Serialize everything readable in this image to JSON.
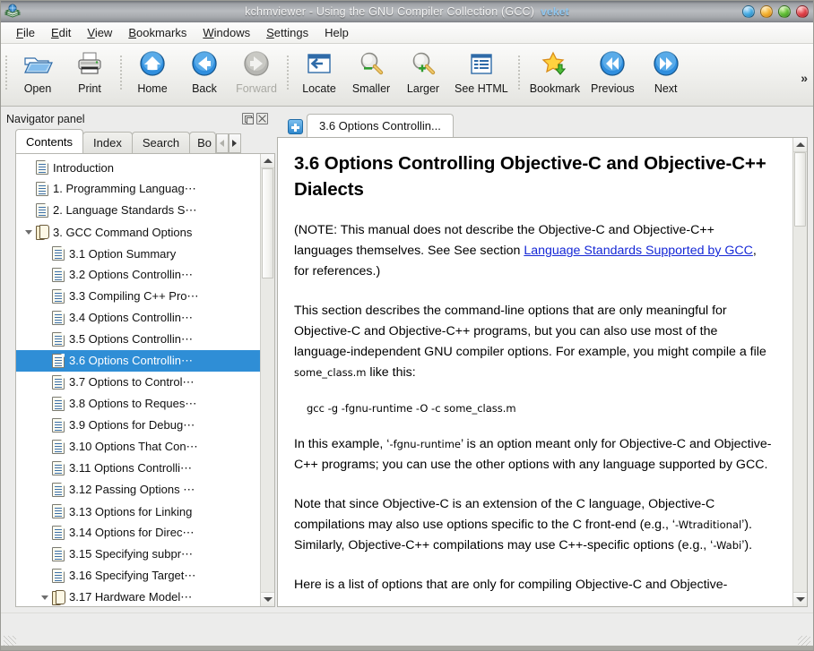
{
  "window": {
    "app_icon": "book-globe-icon",
    "title": "kchmviewer  -  Using  the  GNU  Compiler  Collection  (GCC)",
    "title_suffix": "veket",
    "buttons": [
      {
        "name": "shade-button",
        "color": "#49aee4"
      },
      {
        "name": "minimize-button",
        "color": "#f5b536"
      },
      {
        "name": "maximize-button",
        "color": "#66c23a"
      },
      {
        "name": "close-button",
        "color": "#e3484f"
      }
    ]
  },
  "menubar": {
    "items": [
      {
        "label": "File",
        "accel": "F"
      },
      {
        "label": "Edit",
        "accel": "E"
      },
      {
        "label": "View",
        "accel": "V"
      },
      {
        "label": "Bookmarks",
        "accel": "B"
      },
      {
        "label": "Windows",
        "accel": "W"
      },
      {
        "label": "Settings",
        "accel": "S"
      },
      {
        "label": "Help",
        "accel": "H"
      }
    ]
  },
  "toolbar": {
    "overflow_label": "»",
    "buttons": [
      {
        "label": "Open",
        "icon": "open-folder-icon",
        "disabled": false
      },
      {
        "label": "Print",
        "icon": "printer-icon",
        "disabled": false
      },
      {
        "label": "Home",
        "icon": "home-icon",
        "disabled": false
      },
      {
        "label": "Back",
        "icon": "back-arrow-icon",
        "disabled": false
      },
      {
        "label": "Forward",
        "icon": "forward-arrow-icon",
        "disabled": true
      },
      {
        "label": "Locate",
        "icon": "locate-icon",
        "disabled": false
      },
      {
        "label": "Smaller",
        "icon": "zoom-out-icon",
        "disabled": false
      },
      {
        "label": "Larger",
        "icon": "zoom-in-icon",
        "disabled": false
      },
      {
        "label": "See HTML",
        "icon": "see-html-icon",
        "disabled": false
      },
      {
        "label": "Bookmark",
        "icon": "bookmark-star-icon",
        "disabled": false
      },
      {
        "label": "Previous",
        "icon": "previous-icon",
        "disabled": false
      },
      {
        "label": "Next",
        "icon": "next-icon",
        "disabled": false
      }
    ]
  },
  "navigator": {
    "title": "Navigator panel",
    "float_icon": "float-panel-icon",
    "close_icon": "close-panel-icon",
    "tabs": [
      {
        "label": "Contents",
        "active": true
      },
      {
        "label": "Index",
        "active": false
      },
      {
        "label": "Search",
        "active": false
      },
      {
        "label": "Bo",
        "active": false,
        "clipped": true
      }
    ],
    "tab_scroll_left": "chevron-left-icon",
    "tab_scroll_right": "chevron-right-icon",
    "tree": [
      {
        "label": "Introduction",
        "indent": 1,
        "icon": "page-icon",
        "twisty": false,
        "selected": false
      },
      {
        "label": "1. Programming Languag⋯",
        "indent": 1,
        "icon": "page-icon",
        "twisty": false,
        "selected": false
      },
      {
        "label": "2. Language Standards S⋯",
        "indent": 1,
        "icon": "page-icon",
        "twisty": false,
        "selected": false
      },
      {
        "label": "3. GCC Command Options",
        "indent": 1,
        "icon": "book-icon",
        "twisty": true,
        "selected": false
      },
      {
        "label": "3.1 Option Summary",
        "indent": 2,
        "icon": "page-icon",
        "twisty": false,
        "selected": false
      },
      {
        "label": "3.2 Options Controllin⋯",
        "indent": 2,
        "icon": "page-icon",
        "twisty": false,
        "selected": false
      },
      {
        "label": "3.3 Compiling C++ Pro⋯",
        "indent": 2,
        "icon": "page-icon",
        "twisty": false,
        "selected": false
      },
      {
        "label": "3.4 Options Controllin⋯",
        "indent": 2,
        "icon": "page-icon",
        "twisty": false,
        "selected": false
      },
      {
        "label": "3.5 Options Controllin⋯",
        "indent": 2,
        "icon": "page-icon",
        "twisty": false,
        "selected": false
      },
      {
        "label": "3.6 Options Controllin⋯",
        "indent": 2,
        "icon": "page-icon",
        "twisty": false,
        "selected": true
      },
      {
        "label": "3.7 Options to Control⋯",
        "indent": 2,
        "icon": "page-icon",
        "twisty": false,
        "selected": false
      },
      {
        "label": "3.8 Options to Reques⋯",
        "indent": 2,
        "icon": "page-icon",
        "twisty": false,
        "selected": false
      },
      {
        "label": "3.9 Options for Debug⋯",
        "indent": 2,
        "icon": "page-icon",
        "twisty": false,
        "selected": false
      },
      {
        "label": "3.10 Options That Con⋯",
        "indent": 2,
        "icon": "page-icon",
        "twisty": false,
        "selected": false
      },
      {
        "label": "3.11 Options Controlli⋯",
        "indent": 2,
        "icon": "page-icon",
        "twisty": false,
        "selected": false
      },
      {
        "label": "3.12 Passing Options ⋯",
        "indent": 2,
        "icon": "page-icon",
        "twisty": false,
        "selected": false
      },
      {
        "label": "3.13 Options for Linking",
        "indent": 2,
        "icon": "page-icon",
        "twisty": false,
        "selected": false
      },
      {
        "label": "3.14 Options for Direc⋯",
        "indent": 2,
        "icon": "page-icon",
        "twisty": false,
        "selected": false
      },
      {
        "label": "3.15 Specifying subpr⋯",
        "indent": 2,
        "icon": "page-icon",
        "twisty": false,
        "selected": false
      },
      {
        "label": "3.16 Specifying Target⋯",
        "indent": 2,
        "icon": "page-icon",
        "twisty": false,
        "selected": false
      },
      {
        "label": "3.17 Hardware Model⋯",
        "indent": 2,
        "icon": "book-icon",
        "twisty": true,
        "selected": false
      }
    ],
    "scrollbar": {
      "up_icon": "scroll-up-icon",
      "down_icon": "scroll-down-icon",
      "thumb_top_pct": 0,
      "thumb_height_pct": 26
    }
  },
  "content": {
    "add_tab_icon": "add-tab-icon",
    "tabs": [
      {
        "label": "3.6 Options Controllin...",
        "active": true
      }
    ],
    "document": {
      "heading": "3.6 Options Controlling Objective-C and Objective-C++ Dialects",
      "para1_before_link": "(NOTE: This manual does not describe the Objective-C and Objective-C++ languages themselves. See See section ",
      "para1_link": "Language Standards Supported by GCC",
      "para1_after_link": ", for references.)",
      "para2_a": "This section describes the command-line options that are only meaningful for Objective-C and Objective-C++ programs, but you can also use most of the language-independent GNU compiler options. For example, you might compile a file ",
      "para2_code": "some_class.m",
      "para2_b": " like this:",
      "codeblock": "gcc -g -fgnu-runtime -O -c some_class.m",
      "para3_a": "In this example, ‘",
      "para3_code1": "-fgnu-runtime",
      "para3_b": "’ is an option meant only for Objective-C and Objective-C++ programs; you can use the other options with any language supported by GCC.",
      "para4_a": "Note that since Objective-C is an extension of the C language, Objective-C compilations may also use options specific to the C front-end (e.g., ‘",
      "para4_code1": "-Wtraditional",
      "para4_b": "’). Similarly, Objective-C++ compilations may use C++-specific options (e.g., ‘",
      "para4_code2": "-Wabi",
      "para4_c": "’).",
      "para5_clipped": "Here is a list of options that are only for compiling Objective-C and Objective-"
    },
    "scrollbar": {
      "up_icon": "scroll-up-icon",
      "down_icon": "scroll-down-icon",
      "thumb_top_pct": 0,
      "thumb_height_pct": 17
    }
  }
}
